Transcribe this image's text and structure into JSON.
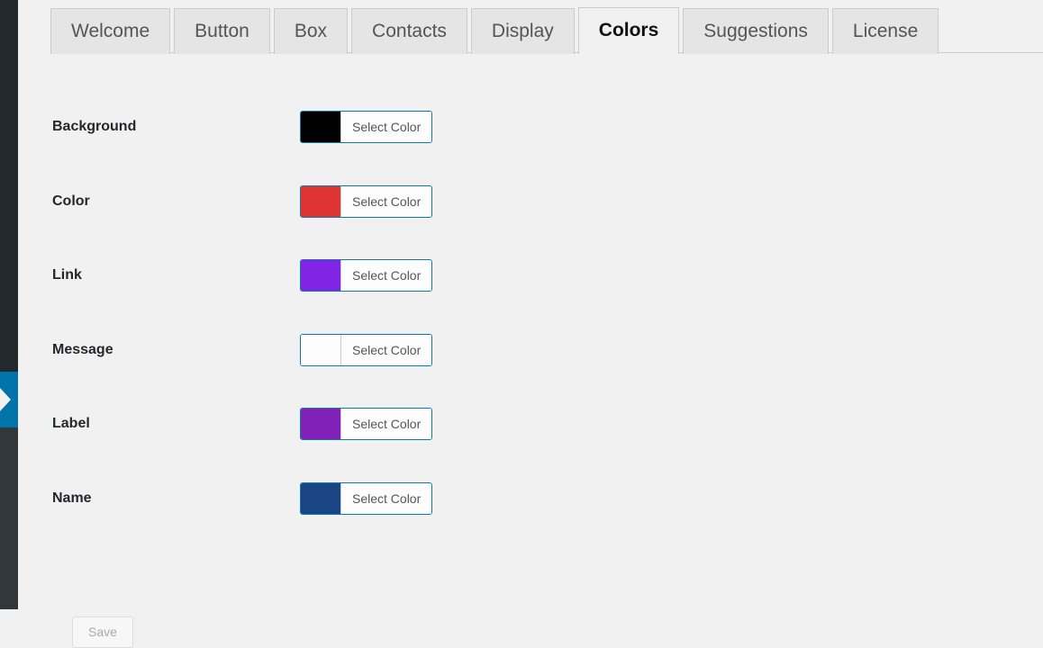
{
  "window": {
    "background_color": "#f1f1f1",
    "rail_color": "#23282d",
    "rail_lower_color": "#32373c",
    "collapse_accent": "#0073aa"
  },
  "sidebar": {
    "collapse_handle_name": "collapse menu",
    "collapse_icon": "chevron-left-icon"
  },
  "tabs": {
    "active": "Colors",
    "items": [
      {
        "label": "Welcome",
        "active": false
      },
      {
        "label": "Button",
        "active": false
      },
      {
        "label": "Box",
        "active": false
      },
      {
        "label": "Contacts",
        "active": false
      },
      {
        "label": "Display",
        "active": false
      },
      {
        "label": "Colors",
        "active": true
      },
      {
        "label": "Suggestions",
        "active": false
      },
      {
        "label": "License",
        "active": false
      }
    ]
  },
  "settings": {
    "select_color_label": "Select Color",
    "rows": [
      {
        "label": "Background",
        "value": "#000000"
      },
      {
        "label": "Color",
        "value": "#dd3333"
      },
      {
        "label": "Link",
        "value": "#8224e3"
      },
      {
        "label": "Message",
        "value": "#fdfdfd"
      },
      {
        "label": "Label",
        "value": "#8021b8"
      },
      {
        "label": "Name",
        "value": "#1b4484"
      }
    ]
  },
  "footer": {
    "save_label": "Save",
    "save_disabled": true
  }
}
